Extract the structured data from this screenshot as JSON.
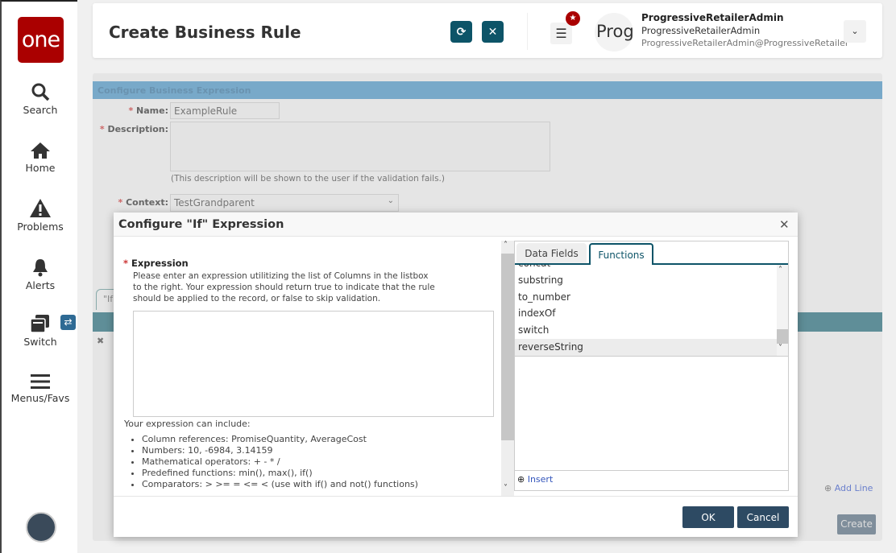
{
  "sidebar": {
    "logo": "one",
    "items": [
      {
        "label": "Search",
        "icon": "search-icon"
      },
      {
        "label": "Home",
        "icon": "home-icon"
      },
      {
        "label": "Problems",
        "icon": "warning-icon"
      },
      {
        "label": "Alerts",
        "icon": "bell-icon"
      },
      {
        "label": "Switch",
        "icon": "switch-icon"
      },
      {
        "label": "Menus/Favs",
        "icon": "menu-icon"
      }
    ]
  },
  "header": {
    "title": "Create Business Rule",
    "avatar_text": "Prog",
    "user_name": "ProgressiveRetailerAdmin",
    "user_role": "ProgressiveRetailerAdmin",
    "user_email": "ProgressiveRetailerAdmin@ProgressiveRetailer"
  },
  "form": {
    "section": "Configure Business Expression",
    "name_label": "Name:",
    "name_value": "ExampleRule",
    "description_label": "Description:",
    "description_hint": "(This description will be shown to the user if the validation fails.)",
    "context_label": "Context:",
    "context_value": "TestGrandparent",
    "tab_partial": "\"If",
    "add_line": "Add Line",
    "create": "Create"
  },
  "modal": {
    "title": "Configure \"If\" Expression",
    "expression_label": "Expression",
    "instructions": "Please enter an expression utilitizing the list of Columns in the listbox to the right. Your expression should return true to indicate that the rule should be applied to the record, or false to skip validation.",
    "expression_value": "",
    "include_heading": "Your expression can include:",
    "include_items": [
      "Column references: PromiseQuantity, AverageCost",
      "Numbers: 10, -6984, 3.14159",
      "Mathematical operators: + - * /",
      "Predefined functions: min(), max(), if()",
      "Comparators: > >= = <= < (use with if() and not() functions)"
    ],
    "tabs": [
      "Data Fields",
      "Functions"
    ],
    "active_tab": "Functions",
    "functions": [
      "concat",
      "substring",
      "to_number",
      "indexOf",
      "switch",
      "reverseString"
    ],
    "selected_function": "reverseString",
    "insert": "Insert",
    "ok": "OK",
    "cancel": "Cancel"
  },
  "colors": {
    "accent": "#0d5468",
    "brand": "#aa0000",
    "button": "#2d4a63",
    "section": "#78a9c9"
  }
}
